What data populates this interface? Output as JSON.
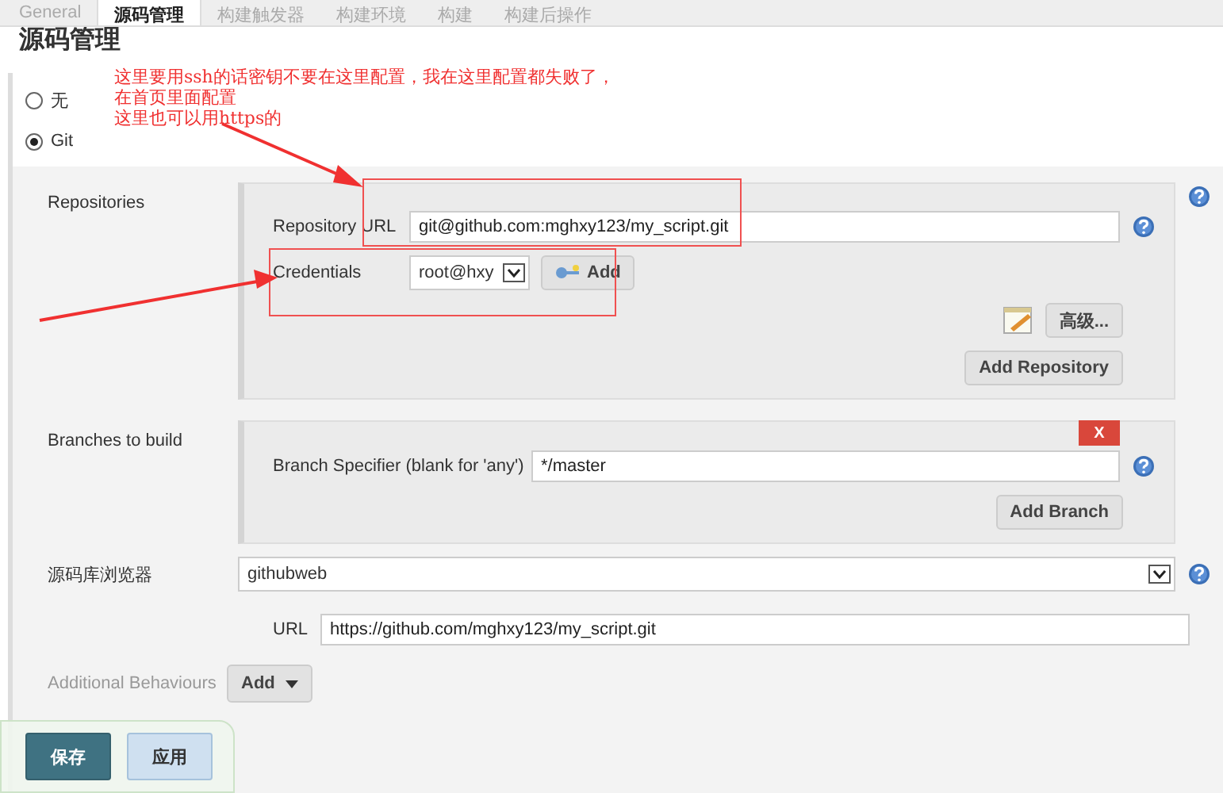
{
  "tabs": [
    {
      "label": "General",
      "selected": false
    },
    {
      "label": "源码管理",
      "selected": true
    },
    {
      "label": "构建触发器",
      "selected": false
    },
    {
      "label": "构建环境",
      "selected": false
    },
    {
      "label": "构建",
      "selected": false
    },
    {
      "label": "构建后操作",
      "selected": false
    }
  ],
  "heading": "源码管理",
  "scm_options": [
    {
      "label": "无",
      "selected": false
    },
    {
      "label": "Git",
      "selected": true
    }
  ],
  "repositories": {
    "label": "Repositories",
    "url_label": "Repository URL",
    "url_value": "git@github.com:mghxy123/my_script.git",
    "credentials_label": "Credentials",
    "credentials_value": "root@hxy",
    "add_button": "Add",
    "advanced_button": "高级...",
    "add_repository_button": "Add Repository"
  },
  "branches": {
    "label": "Branches to build",
    "delete_button": "X",
    "specifier_label": "Branch Specifier (blank for 'any')",
    "specifier_value": "*/master",
    "add_branch_button": "Add Branch"
  },
  "repository_browser": {
    "label": "源码库浏览器",
    "value": "githubweb",
    "url_label": "URL",
    "url_value": "https://github.com/mghxy123/my_script.git"
  },
  "additional_behaviours": {
    "label": "Additional Behaviours",
    "add_button": "Add"
  },
  "annotation": {
    "lines": [
      "这里要用ssh的话密钥不要在这里配置，我在这里配置都失败了，",
      "在首页里面配置",
      "这里也可以用https的"
    ]
  },
  "footer_buttons": [
    {
      "label": "保存",
      "kind": "primary"
    },
    {
      "label": "应用",
      "kind": "secondary"
    }
  ]
}
